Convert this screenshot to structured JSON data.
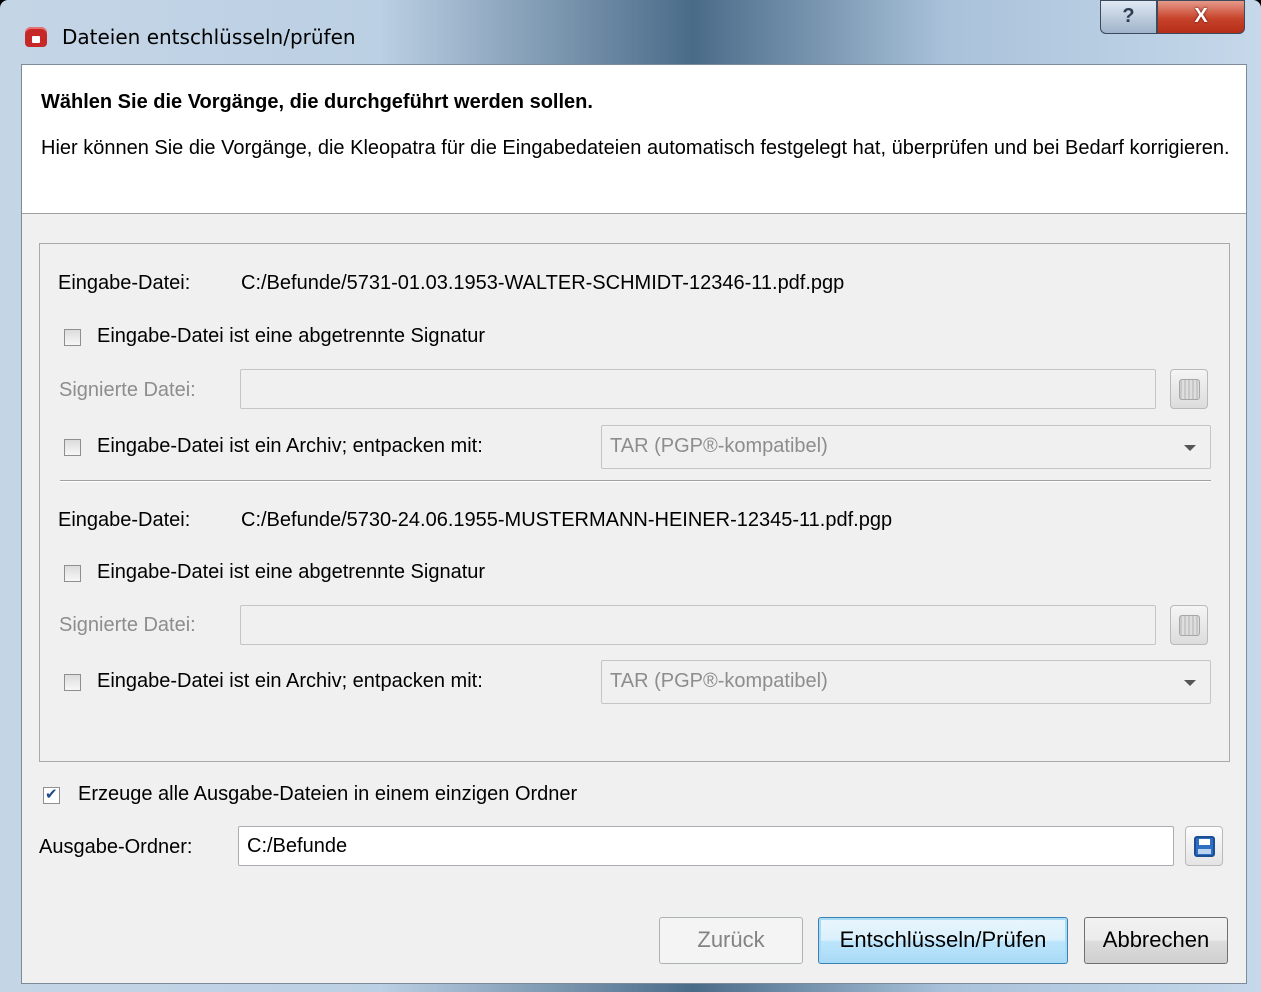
{
  "window": {
    "title": "Dateien entschlüsseln/prüfen",
    "help_label": "?",
    "close_label": "X"
  },
  "header": {
    "title": "Wählen Sie die Vorgänge, die durchgeführt werden sollen.",
    "subtitle": "Hier können Sie die Vorgänge, die Kleopatra für die Eingabedateien automatisch festgelegt hat, überprüfen und bei Bedarf korrigieren."
  },
  "files": [
    {
      "input_label": "Eingabe-Datei:",
      "input_path": "C:/Befunde/5731-01.03.1953-WALTER-SCHMIDT-12346-11.pdf.pgp",
      "detached_sig_label": "Eingabe-Datei ist eine abgetrennte Signatur",
      "detached_sig_checked": false,
      "signed_file_label": "Signierte Datei:",
      "signed_file_value": "",
      "archive_label": "Eingabe-Datei ist ein Archiv; entpacken mit:",
      "archive_checked": false,
      "archive_format": "TAR (PGP®-kompatibel)"
    },
    {
      "input_label": "Eingabe-Datei:",
      "input_path": "C:/Befunde/5730-24.06.1955-MUSTERMANN-HEINER-12345-11.pdf.pgp",
      "detached_sig_label": "Eingabe-Datei ist eine abgetrennte Signatur",
      "detached_sig_checked": false,
      "signed_file_label": "Signierte Datei:",
      "signed_file_value": "",
      "archive_label": "Eingabe-Datei ist ein Archiv; entpacken mit:",
      "archive_checked": false,
      "archive_format": "TAR (PGP®-kompatibel)"
    }
  ],
  "output": {
    "single_folder_label": "Erzeuge alle Ausgabe-Dateien in einem einzigen Ordner",
    "single_folder_checked": true,
    "folder_label": "Ausgabe-Ordner:",
    "folder_value": "C:/Befunde"
  },
  "buttons": {
    "back": "Zurück",
    "decrypt": "Entschlüsseln/Prüfen",
    "cancel": "Abbrechen"
  },
  "colors": {
    "dialog_bg": "#f0f0f0",
    "close_red": "#c7432b",
    "default_button_blue": "#3c7fb1"
  }
}
